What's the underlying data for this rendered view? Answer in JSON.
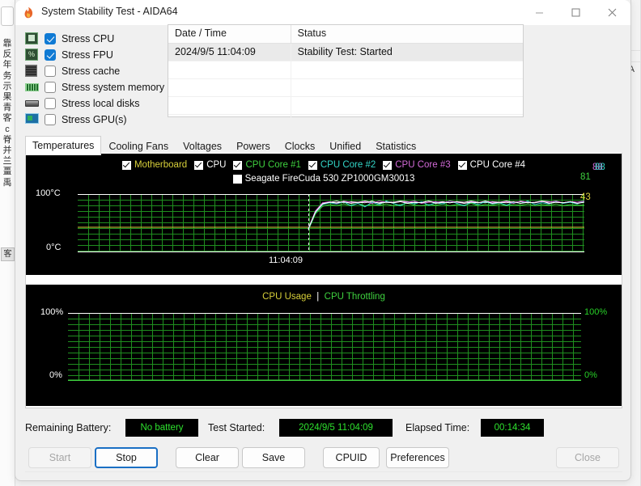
{
  "window": {
    "title": "System Stability Test - AIDA64",
    "icon": "flame-icon",
    "controls": {
      "minimize": "minimize-icon",
      "maximize": "maximize-icon",
      "close": "close-icon"
    }
  },
  "options": [
    {
      "label": "Stress CPU",
      "checked": true,
      "icon": "cpu-chip-icon"
    },
    {
      "label": "Stress FPU",
      "checked": true,
      "icon": "fpu-percent-icon"
    },
    {
      "label": "Stress cache",
      "checked": false,
      "icon": "cache-chip-icon"
    },
    {
      "label": "Stress system memory",
      "checked": false,
      "icon": "memory-dimm-icon"
    },
    {
      "label": "Stress local disks",
      "checked": false,
      "icon": "hard-disk-icon"
    },
    {
      "label": "Stress GPU(s)",
      "checked": false,
      "icon": "gpu-card-icon"
    }
  ],
  "log": {
    "columns": [
      "Date / Time",
      "Status"
    ],
    "rows": [
      {
        "datetime": "2024/9/5 11:04:09",
        "status": "Stability Test: Started"
      }
    ],
    "empty_row_count": 5
  },
  "tabs": [
    {
      "label": "Temperatures",
      "active": true
    },
    {
      "label": "Cooling Fans",
      "active": false
    },
    {
      "label": "Voltages",
      "active": false
    },
    {
      "label": "Powers",
      "active": false
    },
    {
      "label": "Clocks",
      "active": false
    },
    {
      "label": "Unified",
      "active": false
    },
    {
      "label": "Statistics",
      "active": false
    }
  ],
  "temperature_legend": [
    {
      "label": "Motherboard",
      "checked": true,
      "color": "#d8d03a"
    },
    {
      "label": "CPU",
      "checked": true,
      "color": "#ffffff"
    },
    {
      "label": "CPU Core #1",
      "checked": true,
      "color": "#3fd23f"
    },
    {
      "label": "CPU Core #2",
      "checked": true,
      "color": "#33d6c8"
    },
    {
      "label": "CPU Core #3",
      "checked": true,
      "color": "#d36ad8"
    },
    {
      "label": "CPU Core #4",
      "checked": true,
      "color": "#ffffff"
    },
    {
      "label": "Seagate FireCuda 530 ZP1000GM30013",
      "checked": false,
      "color": "#ffffff"
    }
  ],
  "cpu_chart_legend": [
    {
      "label": "CPU Usage",
      "color": "#d8d03a"
    },
    {
      "label": "CPU Throttling",
      "color": "#3fd23f"
    }
  ],
  "chart_data": [
    {
      "type": "line",
      "name": "temperatures-chart",
      "title": "",
      "ylabel": "",
      "xlabel": "",
      "y_axis_top_label": "100°C",
      "y_axis_bottom_label": "0°C",
      "ylim": [
        0,
        100
      ],
      "grid": true,
      "grid_color": "#1f8f1f",
      "background": "#000000",
      "marker_time_label": "11:04:09",
      "marker_x_fraction": 0.455,
      "right_value_labels": [
        {
          "value": "88",
          "color": "#d36ad8"
        },
        {
          "value": "88",
          "color": "#33d6c8"
        },
        {
          "value": "81",
          "color": "#3fd23f"
        },
        {
          "value": "43",
          "color": "#d8d03a"
        }
      ],
      "series": [
        {
          "name": "Motherboard",
          "color": "#d8d03a",
          "steady_value": 43,
          "values": [
            43,
            43,
            43,
            43,
            43,
            43,
            43,
            43,
            43,
            43,
            43,
            43,
            43,
            43,
            43,
            43,
            43,
            43,
            43,
            43,
            43,
            43,
            43,
            43,
            43,
            43,
            43,
            43,
            43,
            43,
            43,
            43,
            43,
            43,
            43,
            43,
            43,
            43,
            43,
            43
          ]
        },
        {
          "name": "CPU",
          "color": "#ffffff",
          "steady_value": 86,
          "values": [
            40,
            70,
            84,
            86,
            88,
            85,
            87,
            86,
            88,
            86,
            85,
            87,
            86,
            88,
            87,
            85,
            86,
            88,
            86,
            87,
            85,
            87,
            86,
            88,
            86,
            85,
            87,
            86,
            88,
            86,
            87,
            85,
            86,
            88,
            87,
            86,
            85,
            87,
            86,
            88
          ]
        },
        {
          "name": "CPU Core #1",
          "color": "#3fd23f",
          "steady_value": 81,
          "values": [
            38,
            66,
            79,
            82,
            80,
            83,
            81,
            84,
            80,
            82,
            81,
            83,
            80,
            82,
            84,
            81,
            80,
            82,
            81,
            83,
            80,
            82,
            81,
            84,
            80,
            82,
            81,
            83,
            80,
            82,
            81,
            83,
            80,
            82,
            81,
            83,
            80,
            82,
            81,
            81
          ]
        },
        {
          "name": "CPU Core #2",
          "color": "#33d6c8",
          "steady_value": 88,
          "values": [
            39,
            68,
            82,
            85,
            83,
            87,
            80,
            84,
            78,
            86,
            82,
            88,
            84,
            80,
            86,
            83,
            87,
            81,
            85,
            83,
            88,
            84,
            80,
            86,
            82,
            87,
            83,
            85,
            81,
            86,
            84,
            88,
            82,
            85,
            83,
            87,
            84,
            86,
            83,
            88
          ]
        },
        {
          "name": "CPU Core #3",
          "color": "#d36ad8",
          "steady_value": 88,
          "values": [
            41,
            71,
            85,
            87,
            84,
            88,
            86,
            85,
            87,
            84,
            88,
            86,
            85,
            87,
            86,
            88,
            84,
            86,
            87,
            85,
            88,
            86,
            84,
            87,
            85,
            88,
            86,
            85,
            87,
            84,
            88,
            86,
            85,
            87,
            86,
            88,
            85,
            87,
            86,
            88
          ]
        },
        {
          "name": "CPU Core #4",
          "color": "#ffffff",
          "steady_value": 86,
          "values": [
            40,
            69,
            83,
            86,
            85,
            87,
            84,
            86,
            85,
            88,
            84,
            86,
            85,
            87,
            84,
            86,
            85,
            88,
            84,
            86,
            85,
            87,
            84,
            86,
            85,
            88,
            84,
            86,
            85,
            87,
            84,
            86,
            85,
            88,
            84,
            86,
            85,
            87,
            84,
            86
          ]
        }
      ]
    },
    {
      "type": "line",
      "name": "cpu-usage-chart",
      "title": "CPU Usage  |  CPU Throttling",
      "ylabel": "",
      "xlabel": "",
      "y_axis_top_label": "100%",
      "y_axis_bottom_label": "0%",
      "y_axis_top_label_right": "100%",
      "y_axis_bottom_label_right": "0%",
      "ylim": [
        0,
        100
      ],
      "grid": true,
      "grid_color": "#1f8f1f",
      "background": "#000000",
      "series": [
        {
          "name": "CPU Usage",
          "color": "#d8d03a",
          "values": []
        },
        {
          "name": "CPU Throttling",
          "color": "#3fd23f",
          "values": []
        }
      ]
    }
  ],
  "status": {
    "battery_label": "Remaining Battery:",
    "battery_value": "No battery",
    "started_label": "Test Started:",
    "started_value": "2024/9/5 11:04:09",
    "elapsed_label": "Elapsed Time:",
    "elapsed_value": "00:14:34"
  },
  "buttons": [
    {
      "label": "Start",
      "state": "disabled"
    },
    {
      "label": "Stop",
      "state": "focused"
    },
    {
      "label": "Clear",
      "state": "normal"
    },
    {
      "label": "Save",
      "state": "normal"
    },
    {
      "label": "CPUID",
      "state": "normal"
    },
    {
      "label": "Preferences",
      "state": "normal"
    },
    {
      "label": "Close",
      "state": "disabled"
    }
  ],
  "background": {
    "side_text": "靠反年务示果青客c脊并兰畺禹",
    "side_chip": "客"
  }
}
